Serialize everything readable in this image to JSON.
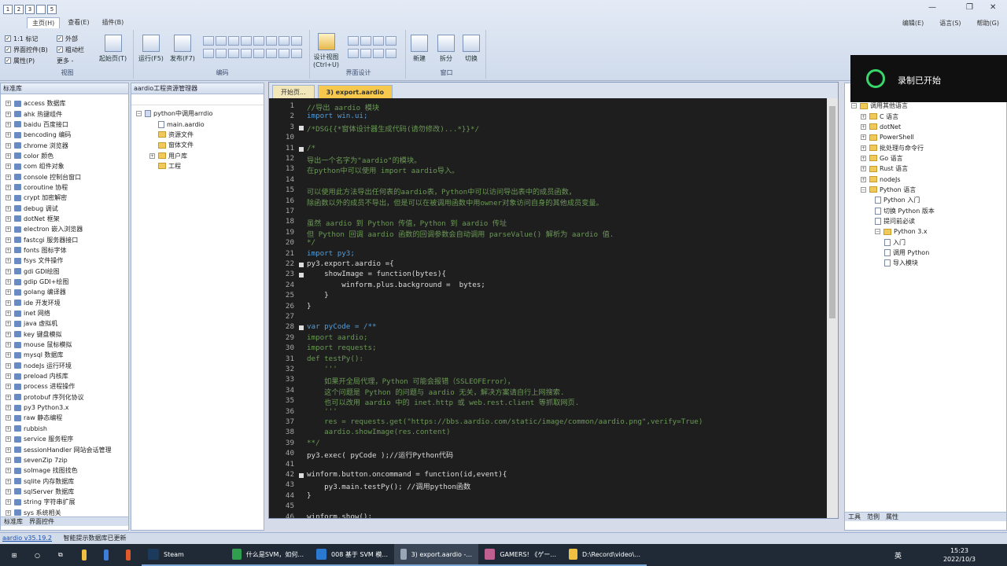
{
  "ribbon": {
    "tabs": [
      "主页(H)",
      "查看(E)",
      "插件(B)"
    ],
    "qat": [
      "1",
      "2",
      "3",
      "",
      "5"
    ],
    "view_group": {
      "label": "视图",
      "items": [
        "1:1 标记",
        "界面控件(B)",
        "属性(P)"
      ],
      "right_items": [
        "外部",
        "粗动栏",
        "更多 -"
      ],
      "start_page": "起始页(T)"
    },
    "code_group": {
      "label": "编码",
      "run": "运行(F5)",
      "publish": "发布(F7)"
    },
    "design_group": {
      "label": "界面设计",
      "design_view": "设计视图\n(Ctrl+U)"
    },
    "window_group": {
      "label": "窗口",
      "new": "新建",
      "split": "拆分",
      "switch": "切换"
    },
    "right_tools": [
      "编辑(E)",
      "语言(S)",
      "帮助(G)"
    ]
  },
  "lib_panel": {
    "title": "标准库",
    "items": [
      "access 数据库",
      "ahk 热键组件",
      "baidu 百度接口",
      "bencoding 编码",
      "chrome 浏览器",
      "color 颜色",
      "com 组件对象",
      "console 控制台窗口",
      "coroutine 协程",
      "crypt 加密解密",
      "debug 调试",
      "dotNet 框架",
      "electron 嵌入浏览器",
      "fastcgi 服务器接口",
      "fonts 图标字体",
      "fsys 文件操作",
      "gdi GDI绘图",
      "gdip GDI+绘图",
      "golang 编译器",
      "ide 开发环境",
      "inet 网络",
      "java 虚拟机",
      "key 键盘模拟",
      "mouse 鼠标模拟",
      "mysql 数据库",
      "nodeJs 运行环境",
      "preload 内核库",
      "process 进程操作",
      "protobuf 序列化协议",
      "py3 Python3.x",
      "raw 静态编程",
      "rubbish",
      "service 服务程序",
      "sessionHandler 网站会话管理",
      "sevenZip 7zip",
      "soImage 找图找色",
      "sqlite 内存数据库",
      "sqlServer 数据库",
      "string 字符串扩展",
      "sys 系统相关"
    ],
    "bottom_tabs": [
      "标准库",
      "界面控件"
    ]
  },
  "project_panel": {
    "title": "aardio工程资源管理器",
    "root": "python中调用arrdio",
    "items": [
      "main.aardio",
      "资源文件",
      "窗体文件",
      "用户库",
      "工程"
    ]
  },
  "editor": {
    "tabs": [
      "开始页...",
      "3) export.aardio"
    ],
    "lines": [
      {
        "n": "1",
        "c": "cm",
        "t": "//导出 aardio 模块"
      },
      {
        "n": "2",
        "c": "kw",
        "t": "import win.ui;"
      },
      {
        "n": "3",
        "c": "cm",
        "t": "/*DSG{{*窗体设计器生成代码(请勿修改)...*}}*/"
      },
      {
        "n": "10",
        "c": "tx",
        "t": ""
      },
      {
        "n": "11",
        "c": "cm",
        "t": "/*"
      },
      {
        "n": "12",
        "c": "cm",
        "t": "导出一个名字为\"aardio\"的模块。"
      },
      {
        "n": "13",
        "c": "cm",
        "t": "在python中可以使用 import aardio导入。"
      },
      {
        "n": "14",
        "c": "cm",
        "t": ""
      },
      {
        "n": "15",
        "c": "cm",
        "t": "可以使用此方法导出任何表的aardio表，Python中可以访问导出表中的成员函数，"
      },
      {
        "n": "16",
        "c": "cm",
        "t": "除函数以外的成员不导出，但是可以在被调用函数中用owner对象访问自身的其他成员变量。"
      },
      {
        "n": "17",
        "c": "cm",
        "t": ""
      },
      {
        "n": "18",
        "c": "cm",
        "t": "虽然 aardio 到 Python 传值，Python 到 aardio 传址"
      },
      {
        "n": "19",
        "c": "cm",
        "t": "但 Python 回调 aardio 函数的回调参数会自动调用 parseValue() 解析为 aardio 值."
      },
      {
        "n": "20",
        "c": "cm",
        "t": "*/"
      },
      {
        "n": "21",
        "c": "kw",
        "t": "import py3;"
      },
      {
        "n": "22",
        "c": "tx",
        "t": "py3.export.aardio ={"
      },
      {
        "n": "23",
        "c": "tx",
        "t": "    showImage = function(bytes){"
      },
      {
        "n": "24",
        "c": "tx",
        "t": "        winform.plus.background =  bytes;"
      },
      {
        "n": "25",
        "c": "tx",
        "t": "    }"
      },
      {
        "n": "26",
        "c": "tx",
        "t": "}"
      },
      {
        "n": "27",
        "c": "tx",
        "t": ""
      },
      {
        "n": "28",
        "c": "kw",
        "t": "var pyCode = /**"
      },
      {
        "n": "29",
        "c": "cm",
        "t": "import aardio;"
      },
      {
        "n": "30",
        "c": "cm",
        "t": "import requests;"
      },
      {
        "n": "31",
        "c": "cm",
        "t": "def testPy():"
      },
      {
        "n": "32",
        "c": "cm",
        "t": "    '''"
      },
      {
        "n": "33",
        "c": "cm",
        "t": "    如果开全局代理，Python 可能会报错（SSLEOFError），"
      },
      {
        "n": "34",
        "c": "cm",
        "t": "    这个问题是 Python 的问题与 aardio 无关，解决方案请自行上网搜索."
      },
      {
        "n": "35",
        "c": "cm",
        "t": "    也可以改用 aardio 中的 inet.http 或 web.rest.client 等抓取网页."
      },
      {
        "n": "36",
        "c": "cm",
        "t": "    '''"
      },
      {
        "n": "37",
        "c": "cm",
        "t": "    res = requests.get(\"https://bbs.aardio.com/static/image/common/aardio.png\",verify=True)"
      },
      {
        "n": "38",
        "c": "cm",
        "t": "    aardio.showImage(res.content)"
      },
      {
        "n": "39",
        "c": "cm",
        "t": "**/"
      },
      {
        "n": "40",
        "c": "tx",
        "t": "py3.exec( pyCode );//运行Python代码"
      },
      {
        "n": "41",
        "c": "tx",
        "t": ""
      },
      {
        "n": "42",
        "c": "tx",
        "t": "winform.button.oncommand = function(id,event){"
      },
      {
        "n": "43",
        "c": "tx",
        "t": "    py3.main.testPy(); //调用python函数"
      },
      {
        "n": "44",
        "c": "tx",
        "t": "}"
      },
      {
        "n": "45",
        "c": "tx",
        "t": ""
      },
      {
        "n": "46",
        "c": "tx",
        "t": "winform.show();"
      }
    ]
  },
  "right_panel": {
    "items": [
      {
        "t": "调用其他语言",
        "lvl": 0
      },
      {
        "t": "C 语言",
        "lvl": 1
      },
      {
        "t": "dotNet",
        "lvl": 1
      },
      {
        "t": "PowerShell",
        "lvl": 1
      },
      {
        "t": "批处理与命令行",
        "lvl": 1
      },
      {
        "t": "Go 语言",
        "lvl": 1
      },
      {
        "t": "Rust 语言",
        "lvl": 1
      },
      {
        "t": "nodeJs",
        "lvl": 1
      },
      {
        "t": "Python 语言",
        "lvl": 1
      },
      {
        "t": "Python 入门",
        "lvl": 2
      },
      {
        "t": "切换 Python 版本",
        "lvl": 2
      },
      {
        "t": "提问前必读",
        "lvl": 2
      },
      {
        "t": "Python 3.x",
        "lvl": 2
      },
      {
        "t": "入门",
        "lvl": 3
      },
      {
        "t": "调用 Python",
        "lvl": 3
      },
      {
        "t": "导入模块",
        "lvl": 3
      }
    ],
    "bottom_tabs": [
      "工具",
      "范例",
      "属性"
    ]
  },
  "recording": {
    "text": "录制已开始"
  },
  "status": {
    "link": "aardio v35.19.2",
    "text": "智能提示数据库已更新"
  },
  "taskbar": {
    "apps": [
      "Steam",
      "什么是SVM，如何...",
      "008 基于 SVM 模...",
      "3) export.aardio -...",
      "GAMERS! 《ゲー...",
      "D:\\Record\\video\\..."
    ],
    "time": "15:23",
    "date": "2022/10/3",
    "ime": "英"
  }
}
